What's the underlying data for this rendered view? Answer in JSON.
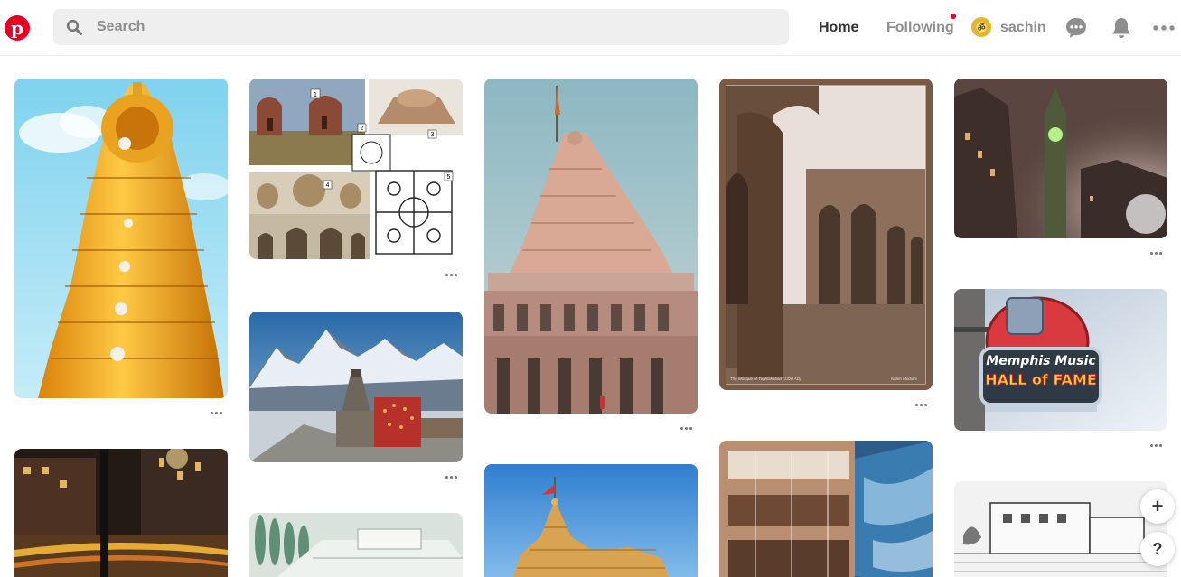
{
  "header": {
    "logo_letter": "p",
    "search": {
      "placeholder": "Search",
      "icon": "search-icon"
    },
    "nav": {
      "home": "Home",
      "following": "Following"
    },
    "profile": {
      "username": "sachin",
      "avatar_symbol": "ॐ"
    },
    "icons": [
      "chat-icon",
      "bell-icon",
      "more-icon"
    ],
    "colors": {
      "brand": "#e60023",
      "search_bg": "#efefef",
      "nav_active": "#333333",
      "nav_inactive": "#8e8e8e"
    }
  },
  "pins": [
    {
      "subject": "South Indian temple gopuram"
    },
    {
      "subject": "Architecture collage with numbered figures",
      "figure_labels": [
        "1",
        "2",
        "3",
        "4",
        "5"
      ]
    },
    {
      "subject": "Mahakaleshwar temple"
    },
    {
      "subject": "Brick arches of a mosque",
      "caption_left": "The Mosque of Tughlakabad (1320 AD)",
      "caption_right": "Naleh Modiabi"
    },
    {
      "subject": "Big Ben at night in fog"
    },
    {
      "subject": "Temple in snowy mountains"
    },
    {
      "subject": "Memphis Music Hall of Fame sign",
      "sign_line1": "Memphis Music",
      "sign_line2": "HALL of FAME"
    },
    {
      "subject": "City street at night"
    },
    {
      "subject": "Restaurant interior with mural"
    },
    {
      "subject": "Garden architecture drawing"
    },
    {
      "subject": "Somnath temple"
    },
    {
      "subject": "Black and white building sketch"
    }
  ],
  "floating_buttons": {
    "add": "+",
    "help": "?"
  }
}
